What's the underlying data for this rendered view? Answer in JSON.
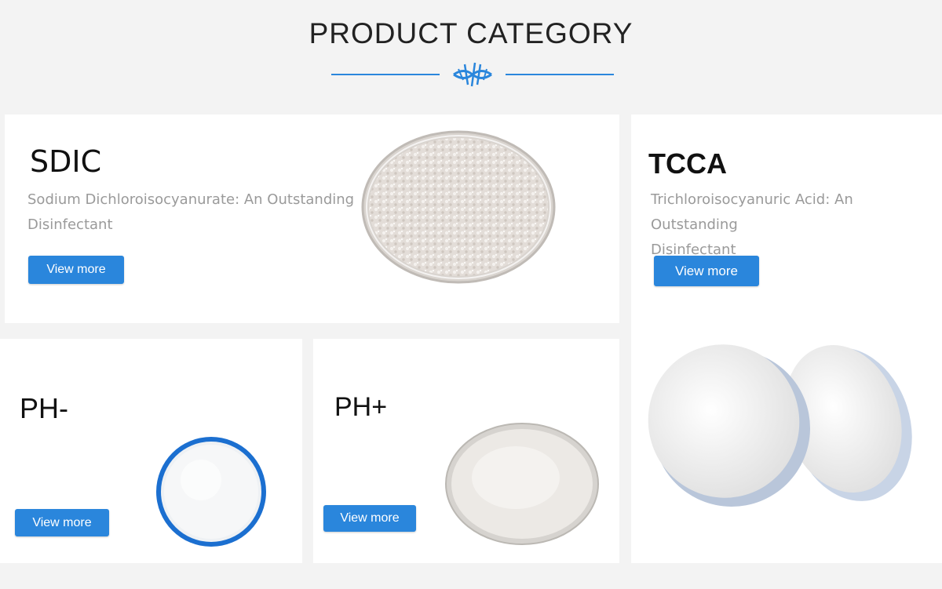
{
  "header": {
    "title": "PRODUCT CATEGORY"
  },
  "accent_color": "#2a86dc",
  "products": [
    {
      "name": "SDIC",
      "description_line1": "Sodium Dichloroisocyanurate: An Outstanding",
      "description_line2": "Disinfectant",
      "button": "View more",
      "image": "granular-powder-petri-dish"
    },
    {
      "name": "TCCA",
      "description_line1": "Trichloroisocyanuric Acid: An Outstanding",
      "description_line2": "Disinfectant",
      "button": "View more",
      "image": "chlorine-tablets"
    },
    {
      "name": "PH-",
      "button": "View more",
      "image": "white-powder-blue-dish"
    },
    {
      "name": "PH+",
      "button": "View more",
      "image": "fine-powder-petri-dish"
    }
  ]
}
